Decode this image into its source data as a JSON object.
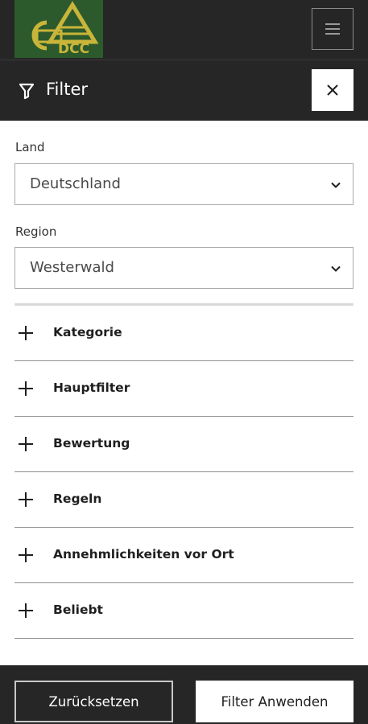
{
  "header": {
    "logo_text": "DCC",
    "menu_icon": "hamburger-menu-icon"
  },
  "filter_panel": {
    "title": "Filter",
    "filter_icon": "funnel-icon",
    "close_icon": "close-icon"
  },
  "fields": {
    "land": {
      "label": "Land",
      "value": "Deutschland"
    },
    "region": {
      "label": "Region",
      "value": "Westerwald"
    }
  },
  "accordion": [
    {
      "label": "Kategorie"
    },
    {
      "label": "Hauptfilter"
    },
    {
      "label": "Bewertung"
    },
    {
      "label": "Regeln"
    },
    {
      "label": "Annehmlichkeiten vor Ort"
    },
    {
      "label": "Beliebt"
    }
  ],
  "footer": {
    "reset_label": "Zurücksetzen",
    "apply_label": "Filter Anwenden"
  },
  "colors": {
    "dark_bg": "#262626",
    "logo_bg": "#2c5a2c",
    "logo_gold": "#c9b53a"
  }
}
